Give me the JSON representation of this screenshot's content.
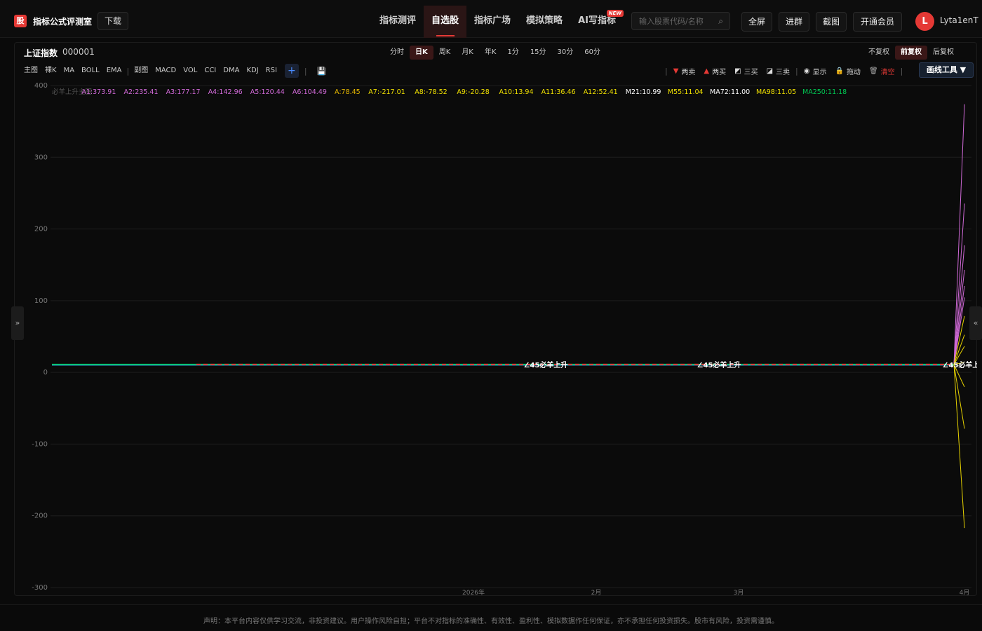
{
  "header": {
    "logo_char": "股",
    "app_title": "指标公式评测室",
    "download_label": "下载",
    "nav": [
      {
        "label": "指标测评",
        "active": false
      },
      {
        "label": "自选股",
        "active": true
      },
      {
        "label": "指标广场",
        "active": false
      },
      {
        "label": "模拟策略",
        "active": false
      },
      {
        "label": "AI写指标",
        "active": false,
        "badge": "NEW"
      }
    ],
    "search_placeholder": "输入股票代码/名称",
    "buttons": [
      "全屏",
      "进群",
      "截图",
      "开通会员"
    ],
    "user_initial": "L",
    "username": "Lyta1enT"
  },
  "symbol": {
    "name": "上证指数",
    "code": "000001"
  },
  "periods": [
    {
      "label": "分时",
      "active": false
    },
    {
      "label": "日K",
      "active": true
    },
    {
      "label": "周K",
      "active": false
    },
    {
      "label": "月K",
      "active": false
    },
    {
      "label": "年K",
      "active": false
    },
    {
      "label": "1分",
      "active": false
    },
    {
      "label": "15分",
      "active": false
    },
    {
      "label": "30分",
      "active": false
    },
    {
      "label": "60分",
      "active": false
    }
  ],
  "adjust": [
    {
      "label": "不复权",
      "active": false
    },
    {
      "label": "前复权",
      "active": true
    },
    {
      "label": "后复权",
      "active": false
    }
  ],
  "indicators_main": [
    "主图",
    "裸K",
    "MA",
    "BOLL",
    "EMA"
  ],
  "indicators_sub": [
    "副图",
    "MACD",
    "VOL",
    "CCI",
    "DMA",
    "KDJ",
    "RSI"
  ],
  "plus_label": "+",
  "draw_actions": [
    {
      "icon": "▼",
      "label": "两卖",
      "color": "#e53935"
    },
    {
      "icon": "▲",
      "label": "两买",
      "color": "#e53935"
    },
    {
      "icon": "◩",
      "label": "三买",
      "color": "#ddd"
    },
    {
      "icon": "◪",
      "label": "三卖",
      "color": "#ddd"
    },
    {
      "icon": "◉",
      "label": "显示",
      "color": "#ddd"
    },
    {
      "icon": "🔒",
      "label": "拖动",
      "color": "#e6b800"
    },
    {
      "icon": "🗑",
      "label": "清空",
      "color": "#aaa"
    }
  ],
  "draw_tools_label": "画线工具 ▼",
  "side_left": "»",
  "side_right": "«",
  "legend": [
    {
      "text": "必羊上升主图",
      "color": "#555555"
    },
    {
      "text": "A1:373.91",
      "color": "#d16ad8"
    },
    {
      "text": "A2:235.41",
      "color": "#d16ad8"
    },
    {
      "text": "A3:177.17",
      "color": "#d16ad8"
    },
    {
      "text": "A4:142.96",
      "color": "#d16ad8"
    },
    {
      "text": "A5:120.44",
      "color": "#d16ad8"
    },
    {
      "text": "A6:104.49",
      "color": "#d16ad8"
    },
    {
      "text": "A:78.45",
      "color": "#e6b800"
    },
    {
      "text": "A7:-217.01",
      "color": "#f0e000"
    },
    {
      "text": "A8:-78.52",
      "color": "#f0e000"
    },
    {
      "text": "A9:-20.28",
      "color": "#f0e000"
    },
    {
      "text": "A10:13.94",
      "color": "#f0e000"
    },
    {
      "text": "A11:36.46",
      "color": "#f0e000"
    },
    {
      "text": "A12:52.41",
      "color": "#f0e000"
    },
    {
      "text": "M21:10.99",
      "color": "#ffffff"
    },
    {
      "text": "M55:11.04",
      "color": "#f0e000"
    },
    {
      "text": "MA72:11.00",
      "color": "#ffffff"
    },
    {
      "text": "MA98:11.05",
      "color": "#f0e000"
    },
    {
      "text": "MA250:11.18",
      "color": "#00c853"
    }
  ],
  "chart_data": {
    "type": "line",
    "ylim": [
      -300,
      400
    ],
    "yticks": [
      400,
      300,
      200,
      100,
      0,
      -100,
      -200,
      -300
    ],
    "xticks": [
      "2026年",
      "2月",
      "3月",
      "4月"
    ],
    "baseline": 11,
    "annotations": [
      "∠45必羊上升",
      "∠45必羊上升",
      "∠45必羊上"
    ],
    "fan_pink_end": [
      373.91,
      235.41,
      177.17,
      142.96,
      120.44,
      104.49
    ],
    "fan_yellow_end": [
      78.45,
      -217.01,
      -78.52,
      -20.28,
      13.94,
      36.46,
      52.41
    ]
  },
  "footer": {
    "disclaimer": "声明：本平台内容仅供学习交流，非投资建议。用户操作风险自担；平台不对指标的准确性、有效性、盈利性、模拟数据作任何保证，亦不承担任何投资损失。股市有风险，投资需谨慎。"
  }
}
